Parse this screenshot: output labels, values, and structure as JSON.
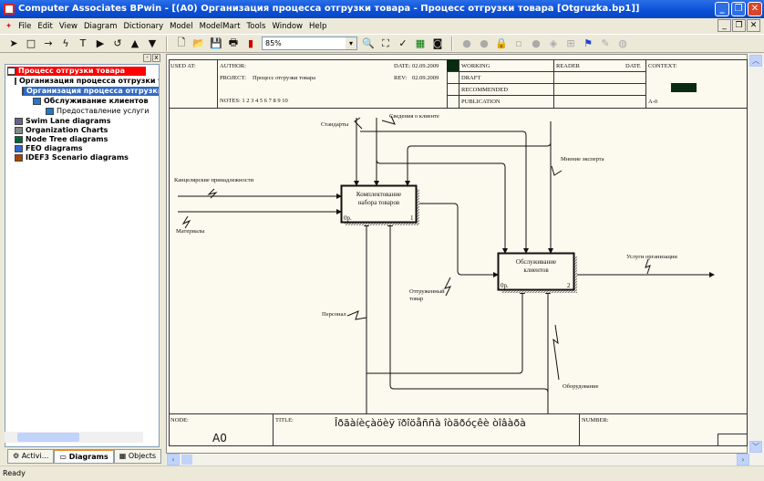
{
  "window": {
    "title": "Computer Associates BPwin - [(A0) Организация процесса отгрузки товара - Процесс отгрузки товара  [Otgruzka.bp1]]"
  },
  "menu": [
    "File",
    "Edit",
    "View",
    "Diagram",
    "Dictionary",
    "Model",
    "ModelMart",
    "Tools",
    "Window",
    "Help"
  ],
  "toolbar": {
    "zoom": "85%"
  },
  "tree": {
    "root": "Процесс отгрузки товара",
    "items": [
      "Организация процесса отгрузки товара",
      "Организация процесса отгрузки товара",
      "Обслуживание клиентов",
      "Предоставление услуги",
      "Swim Lane diagrams",
      "Organization Charts",
      "Node Tree diagrams",
      "FEO diagrams",
      "IDEF3 Scenario diagrams"
    ]
  },
  "tabs": [
    "Activi...",
    "Diagrams",
    "Objects"
  ],
  "header": {
    "used_at": "USED AT:",
    "author": "AUTHOR:",
    "project_label": "PROJECT:",
    "project": "Процесс отгрузки товара",
    "date_label": "DATE:",
    "date": "02.09.2009",
    "rev_label": "REV:",
    "rev": "02.09.2009",
    "notes": "NOTES:  1  2  3  4  5  6  7  8  9  10",
    "status": [
      "WORKING",
      "DRAFT",
      "RECOMMENDED",
      "PUBLICATION"
    ],
    "reader": "READER",
    "date2": "DATE",
    "context": "CONTEXT:",
    "context_node": "A-0"
  },
  "diagram": {
    "boxes": [
      {
        "name": "Комплектование набора товаров",
        "cost": "0р.",
        "number": "1"
      },
      {
        "name": "Обслуживание клиентов",
        "cost": "0р.",
        "number": "2"
      }
    ],
    "arrows": {
      "standards": "Стандарты",
      "client_info": "Сведения о клиенте",
      "stationery": "Канцелярские принадлежности",
      "materials": "Материалы",
      "expert": "Мнение эксперта",
      "shipped1": "Отгруженный",
      "shipped2": "товар",
      "services": "Услуги организации",
      "staff": "Персонал",
      "equipment": "Оборудование"
    }
  },
  "footer": {
    "node_label": "NODE:",
    "node": "A0",
    "title_label": "TITLE:",
    "title": "Îðãàíèçàöèÿ ïðîöåññà  îòãðóçêè òîâàðà",
    "number_label": "NUMBER:"
  },
  "status": "Ready"
}
